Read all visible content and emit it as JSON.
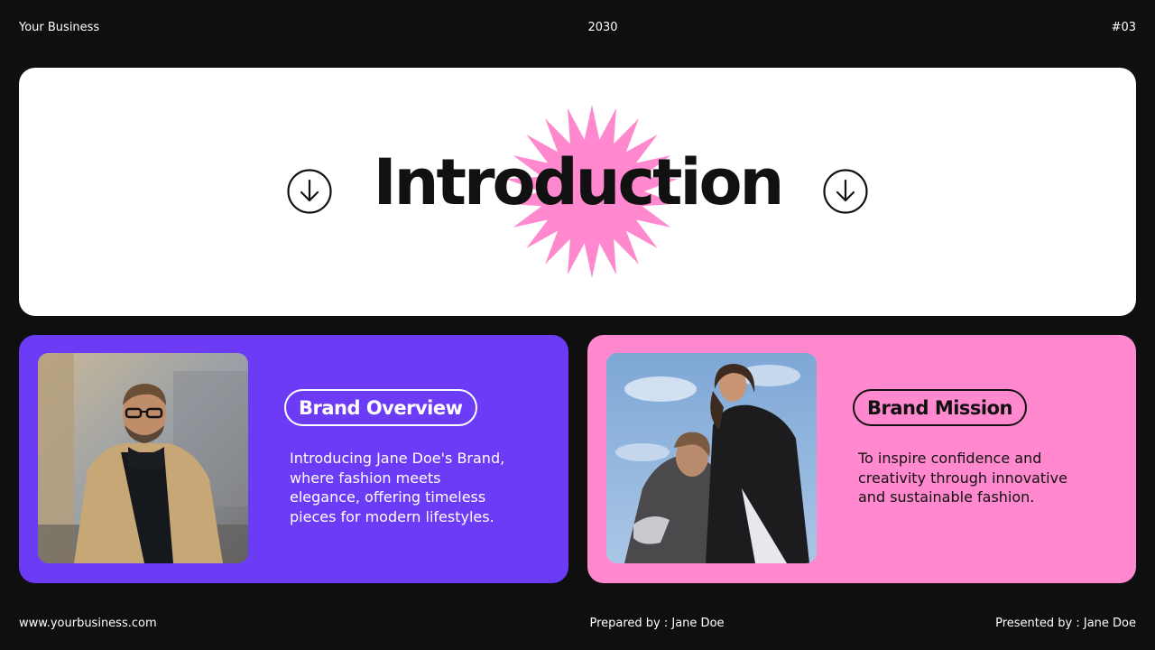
{
  "header": {
    "business": "Your Business",
    "year": "2030",
    "page_number": "#03"
  },
  "hero": {
    "title": "Introduction",
    "decor_icon": "starburst-shape",
    "left_icon": "arrow-down-circle-icon",
    "right_icon": "arrow-down-circle-icon"
  },
  "cards": [
    {
      "label": "Brand Overview",
      "text": "Introducing Jane Doe's Brand, where fashion meets elegance, offering timeless pieces for modern lifestyles.",
      "photo": "man-in-camel-coat-photo"
    },
    {
      "label": "Brand Mission",
      "text": "To inspire confidence and creativity through innovative and sustainable fashion.",
      "photo": "two-women-against-sky-photo"
    }
  ],
  "footer": {
    "website": "www.yourbusiness.com",
    "prepared_by": "Prepared by : Jane Doe",
    "presented_by": "Presented by : Jane Doe"
  },
  "colors": {
    "background": "#0f0f10",
    "card_light": "#ffffff",
    "purple": "#6b3bf5",
    "pink": "#ff88cf",
    "text_dark": "#111111"
  }
}
